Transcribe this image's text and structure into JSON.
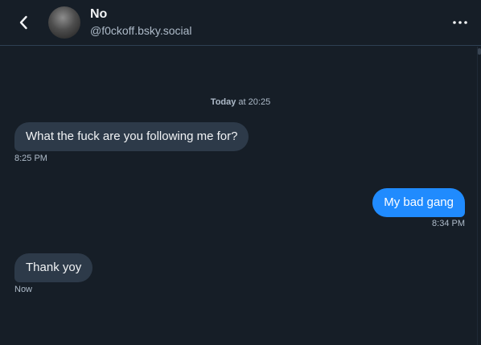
{
  "header": {
    "back_icon": "chevron-left-icon",
    "display_name": "No",
    "handle": "@f0ckoff.bsky.social",
    "more_icon": "more-horizontal-icon"
  },
  "thread": {
    "date_separator": {
      "day": "Today",
      "rest": " at 20:25"
    },
    "messages": [
      {
        "direction": "incoming",
        "text": "What the fuck are you following me for?",
        "time": "8:25 PM"
      },
      {
        "direction": "outgoing",
        "text": "My bad gang",
        "time": "8:34 PM"
      },
      {
        "direction": "incoming",
        "text": "Thank yoy",
        "time": "Now"
      }
    ]
  },
  "colors": {
    "background": "#161e27",
    "incoming_bubble": "#2d3a49",
    "outgoing_bubble": "#208bfe",
    "muted_text": "#aebbc9",
    "divider": "#2e4052"
  }
}
